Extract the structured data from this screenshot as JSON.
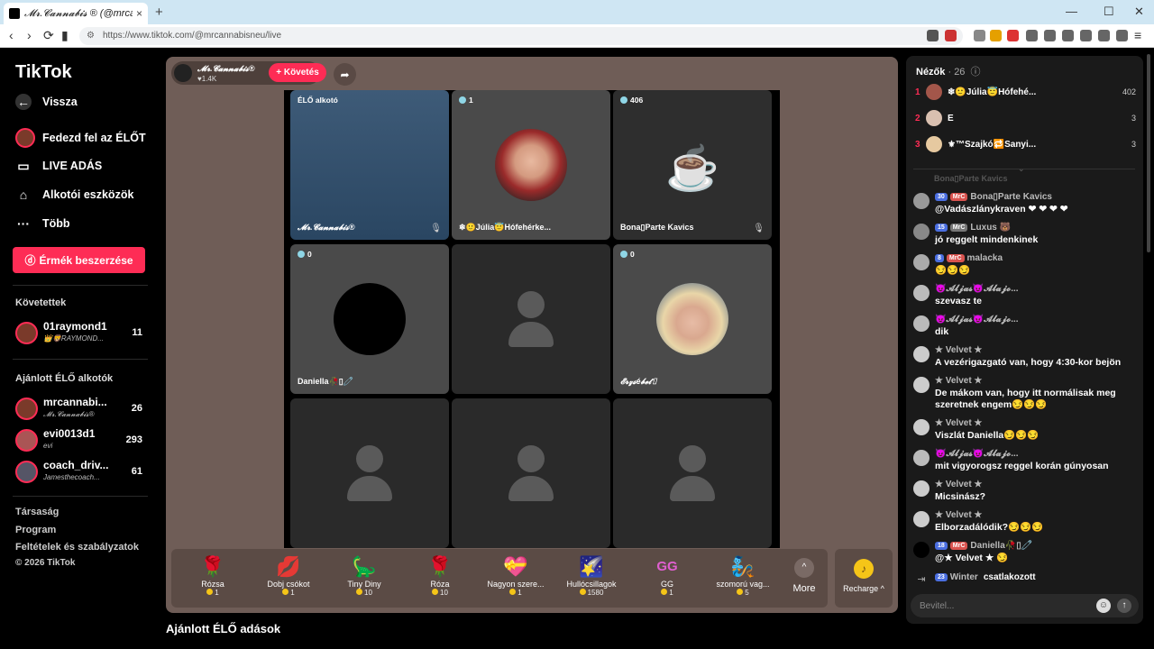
{
  "browser": {
    "tab_title": "𝓜𝓻.𝓒𝓪𝓷𝓷𝓪𝓫𝓲𝓼 ® (@mrcannabisneu) | TikTok",
    "new_tab": "+",
    "url": "https://www.tiktok.com/@mrcannabisneu/live",
    "win_min": "—",
    "win_max": "☐",
    "win_close": "✕",
    "back": "‹",
    "forward": "›",
    "reload": "⟳"
  },
  "sidebar": {
    "logo": "TikTok",
    "back_label": "Vissza",
    "nav": [
      {
        "label": "Fedezd fel az ÉLŐT",
        "icon": "explore-live-icon"
      },
      {
        "label": "LIVE ADÁS",
        "icon": "camera-icon"
      },
      {
        "label": "Alkotói eszközök",
        "icon": "home-icon"
      },
      {
        "label": "Több",
        "icon": "more-dots-icon"
      }
    ],
    "coins_button": "Érmék beszerzése",
    "following_heading": "Követettek",
    "following": [
      {
        "name": "01raymond1",
        "sub": "👑🦁RAYMOND...",
        "count": "11"
      }
    ],
    "recommended_heading": "Ajánlott ÉLŐ alkotók",
    "recommended": [
      {
        "name": "mrcannabi...",
        "sub": "𝓜𝓻.𝓒𝓪𝓷𝓷𝓪𝓫𝓲𝓼®",
        "count": "26"
      },
      {
        "name": "evi0013d1",
        "sub": "evi",
        "count": "293"
      },
      {
        "name": "coach_driv...",
        "sub": "Jamesthecoach...",
        "count": "61"
      }
    ],
    "footer": [
      "Társaság",
      "Program",
      "Feltételek és szabályzatok",
      "© 2026 TikTok"
    ]
  },
  "stream": {
    "host_name": "𝓜𝓻.𝓒𝓪𝓷𝓷𝓪𝓫𝓲𝓼®",
    "host_likes": "♥1.4K",
    "follow_label": "+ Követés",
    "tiles": [
      {
        "tag": "ÉLŐ alkotó",
        "name": "𝓜𝓻.𝓒𝓪𝓷𝓷𝓪𝓫𝓲𝓼®",
        "score": "",
        "kind": "host"
      },
      {
        "tag": "",
        "name": "❄🙂Júlia😇Hófehérke...",
        "score": "1",
        "kind": "avatar"
      },
      {
        "tag": "",
        "name": "Bona▯Parte Kavics",
        "score": "406",
        "kind": "cup"
      },
      {
        "tag": "",
        "name": "Daniella🥀▯🧷",
        "score": "0",
        "kind": "black"
      },
      {
        "tag": "",
        "name": "",
        "score": "",
        "kind": "empty"
      },
      {
        "tag": "",
        "name": "𝓔𝓻𝔃𝓼é𝓫𝓮𝓽▯",
        "score": "0",
        "kind": "avatar2"
      },
      {
        "tag": "",
        "name": "",
        "score": "",
        "kind": "empty"
      },
      {
        "tag": "",
        "name": "",
        "score": "",
        "kind": "empty"
      },
      {
        "tag": "",
        "name": "",
        "score": "",
        "kind": "empty"
      }
    ],
    "gifts": [
      {
        "name": "Rózsa",
        "price": "1",
        "icon": "🌹"
      },
      {
        "name": "Dobj csókot",
        "price": "1",
        "icon": "💋"
      },
      {
        "name": "Tiny Diny",
        "price": "10",
        "icon": "🦕"
      },
      {
        "name": "Róza",
        "price": "10",
        "icon": "🌹"
      },
      {
        "name": "Nagyon szere...",
        "price": "1",
        "icon": "💝"
      },
      {
        "name": "Hullócsillagok",
        "price": "1580",
        "icon": "🌠"
      },
      {
        "name": "GG",
        "price": "1",
        "icon": "GG"
      },
      {
        "name": "szomorú vag...",
        "price": "5",
        "icon": "🧞"
      }
    ],
    "more_label": "More",
    "recharge_label": "Recharge ^",
    "recommended_live": "Ajánlott ÉLŐ adások"
  },
  "chat": {
    "viewers_label": "Nézők",
    "viewers_count": "· 26",
    "ranking": [
      {
        "rank": "1",
        "name": "❄🙂Júlia😇Hófehé...",
        "score": "402"
      },
      {
        "rank": "2",
        "name": "E",
        "score": "3"
      },
      {
        "rank": "3",
        "name": "⚜™Szajkó🔁Sanyi...",
        "score": "3"
      }
    ],
    "faded_text": "Bona▯Parte Kavics",
    "messages": [
      {
        "badges": [
          "30",
          "MrC"
        ],
        "user": "Bona▯Parte Kavics",
        "text": "@Vadászlánykraven ❤ ❤ ❤ ❤"
      },
      {
        "badges": [
          "15",
          "MrC"
        ],
        "user": "Luxus 🐻",
        "text": "jó reggelt mindenkinek"
      },
      {
        "badges": [
          "8",
          "MrC"
        ],
        "user": "malacka",
        "text": "😏😏😏"
      },
      {
        "badges": [],
        "user": "😈𝓐𝓵𝓳𝓪𝓼😈𝓐𝓵𝓪𝓳𝓸...",
        "text": "szevasz te"
      },
      {
        "badges": [],
        "user": "😈𝓐𝓵𝓳𝓪𝓼😈𝓐𝓵𝓪𝓳𝓸...",
        "text": "dik"
      },
      {
        "badges": [],
        "user": "★ Velvet ★",
        "text": "A vezérigazgató van, hogy 4:30-kor bejön"
      },
      {
        "badges": [],
        "user": "★ Velvet ★",
        "text": "De mákom van, hogy itt normálisak meg szeretnek engem😏😏😏"
      },
      {
        "badges": [],
        "user": "★ Velvet ★",
        "text": "Viszlát Daniella😏😏😏"
      },
      {
        "badges": [],
        "user": "😈𝓐𝓵𝓳𝓪𝓼😈𝓐𝓵𝓪𝓳𝓸...",
        "text": "mit vigyorogsz reggel korán gúnyosan"
      },
      {
        "badges": [],
        "user": "★ Velvet ★",
        "text": "Micsinász?"
      },
      {
        "badges": [],
        "user": "★ Velvet ★",
        "text": "Elborzadálódik?😏😏😏"
      },
      {
        "badges": [
          "18",
          "MrC"
        ],
        "user": "Daniella🥀▯🧷",
        "text": "@★ Velvet ★ 😏"
      }
    ],
    "joined": {
      "badge": "23",
      "user": "Winter",
      "text": "csatlakozott"
    },
    "input_placeholder": "Bevitel..."
  }
}
